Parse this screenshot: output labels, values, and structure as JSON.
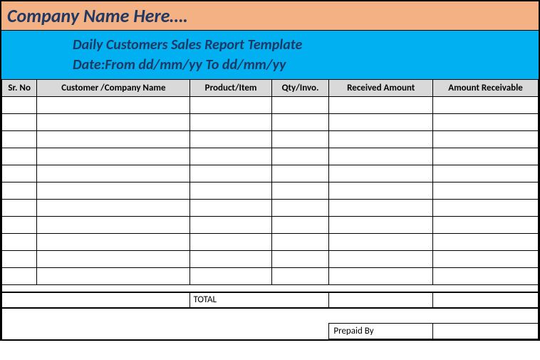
{
  "header": {
    "company_name": "Company Name Here….",
    "title": "Daily Customers Sales Report Template",
    "date_label": "Date:From dd/mm/yy To dd/mm/yy"
  },
  "columns": {
    "sr_no": "Sr. No",
    "customer": "Customer /Company Name",
    "product": "Product/Item",
    "qty": "Qty/Invo.",
    "received": "Received Amount",
    "receivable": "Amount Receivable"
  },
  "rows": [
    {
      "sr": "",
      "customer": "",
      "product": "",
      "qty": "",
      "received": "",
      "receivable": ""
    },
    {
      "sr": "",
      "customer": "",
      "product": "",
      "qty": "",
      "received": "",
      "receivable": ""
    },
    {
      "sr": "",
      "customer": "",
      "product": "",
      "qty": "",
      "received": "",
      "receivable": ""
    },
    {
      "sr": "",
      "customer": "",
      "product": "",
      "qty": "",
      "received": "",
      "receivable": ""
    },
    {
      "sr": "",
      "customer": "",
      "product": "",
      "qty": "",
      "received": "",
      "receivable": ""
    },
    {
      "sr": "",
      "customer": "",
      "product": "",
      "qty": "",
      "received": "",
      "receivable": ""
    },
    {
      "sr": "",
      "customer": "",
      "product": "",
      "qty": "",
      "received": "",
      "receivable": ""
    },
    {
      "sr": "",
      "customer": "",
      "product": "",
      "qty": "",
      "received": "",
      "receivable": ""
    },
    {
      "sr": "",
      "customer": "",
      "product": "",
      "qty": "",
      "received": "",
      "receivable": ""
    },
    {
      "sr": "",
      "customer": "",
      "product": "",
      "qty": "",
      "received": "",
      "receivable": ""
    },
    {
      "sr": "",
      "customer": "",
      "product": "",
      "qty": "",
      "received": "",
      "receivable": ""
    }
  ],
  "footer": {
    "total_label": "TOTAL",
    "prepaid_label": "Prepaid By"
  }
}
